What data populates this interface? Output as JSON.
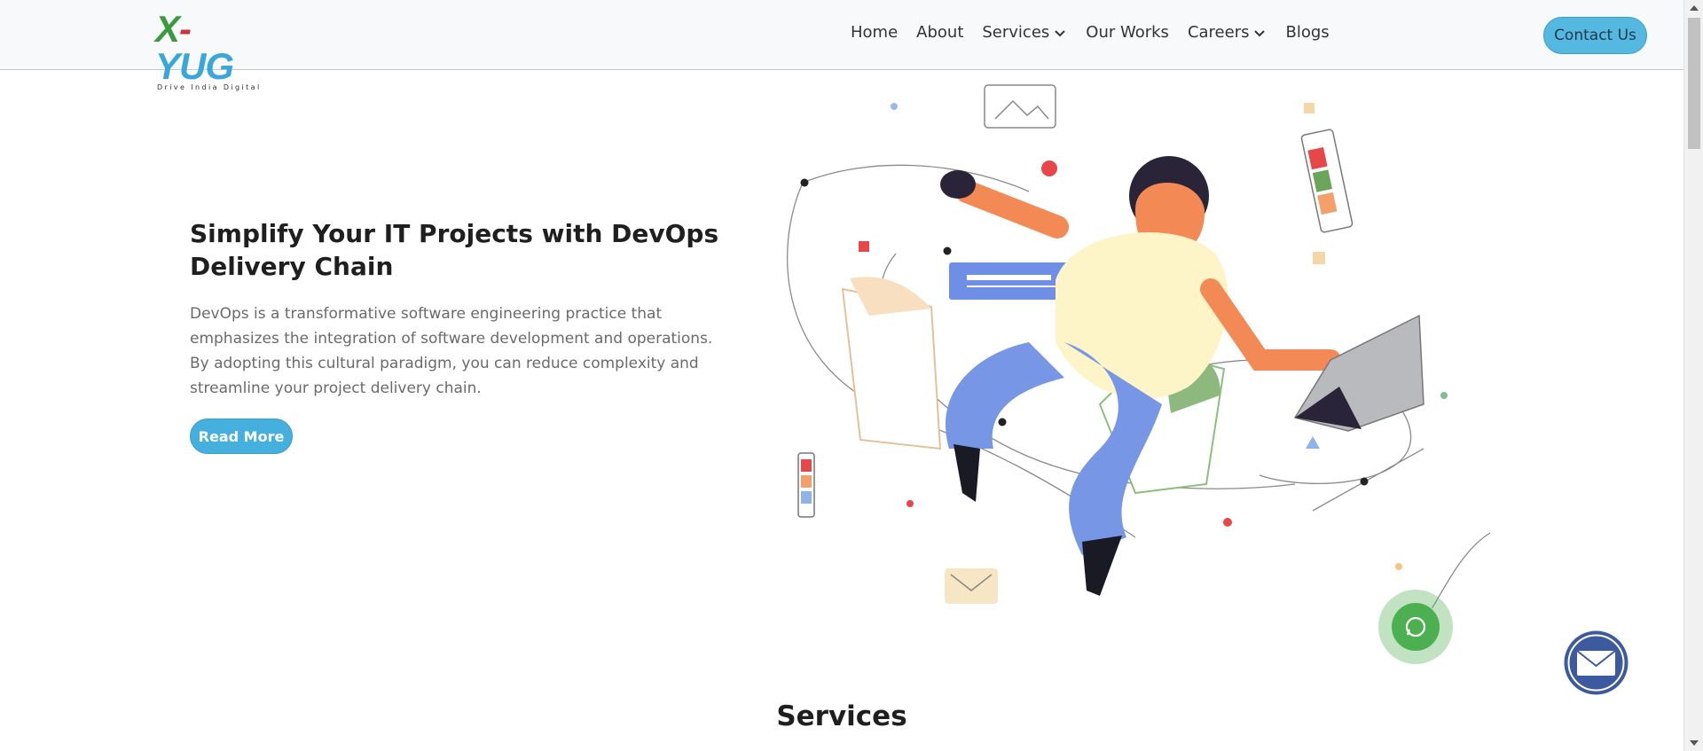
{
  "brand": {
    "logo_x": "X",
    "logo_dash": "-",
    "logo_yug": "YUG",
    "tagline": "Drive India Digital"
  },
  "nav": {
    "items": [
      {
        "label": "Home",
        "dropdown": false
      },
      {
        "label": "About",
        "dropdown": false
      },
      {
        "label": "Services",
        "dropdown": true
      },
      {
        "label": "Our Works",
        "dropdown": false
      },
      {
        "label": "Careers",
        "dropdown": true
      },
      {
        "label": "Blogs",
        "dropdown": false
      }
    ],
    "contact_label": "Contact Us"
  },
  "hero": {
    "title": "Simplify Your IT Projects with DevOps Delivery Chain",
    "description": "DevOps is a transformative software engineering practice that emphasizes the integration of software development and operations. By adopting this cultural paradigm, you can reduce complexity and streamline your project delivery chain.",
    "cta_label": "Read More"
  },
  "sections": {
    "services_heading": "Services"
  },
  "floating": {
    "whatsapp_icon": "whatsapp-icon",
    "mail_icon": "mail-icon"
  },
  "colors": {
    "accent": "#45b0dd",
    "header_bg": "#f8f9fa",
    "whatsapp_green": "#4caf50",
    "mail_blue": "#3d5a9e"
  }
}
